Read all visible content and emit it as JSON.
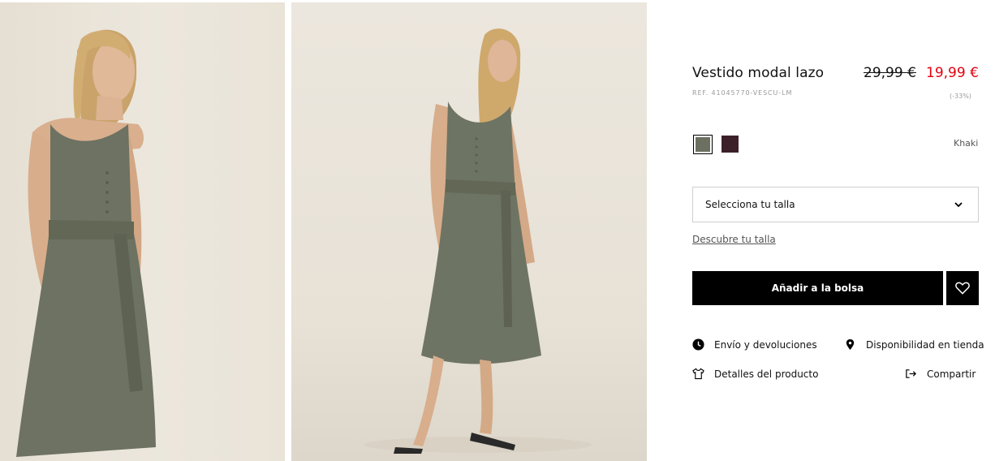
{
  "product": {
    "title": "Vestido modal lazo",
    "price_old": "29,99 €",
    "price_new": "19,99 €",
    "reference": "REF. 41045770-VESCU-LM",
    "discount": "(-33%)",
    "selected_color_name": "Khaki",
    "colors": [
      {
        "name": "khaki",
        "hex": "#6c7061",
        "selected": true
      },
      {
        "name": "burgundy",
        "hex": "#3c2029",
        "selected": false
      }
    ],
    "price_color": "#e3000f"
  },
  "size": {
    "select_label": "Selecciona tu talla",
    "guide_link": "Descubre tu talla"
  },
  "actions": {
    "add_to_bag": "Añadir a la bolsa",
    "favorite_icon": "heart-icon"
  },
  "links": {
    "shipping": "Envío y devoluciones",
    "store_availability": "Disponibilidad en tienda",
    "product_details": "Detalles del producto",
    "share": "Compartir"
  },
  "images": [
    {
      "icon": "product-photo-closeup"
    },
    {
      "icon": "product-photo-full"
    }
  ]
}
